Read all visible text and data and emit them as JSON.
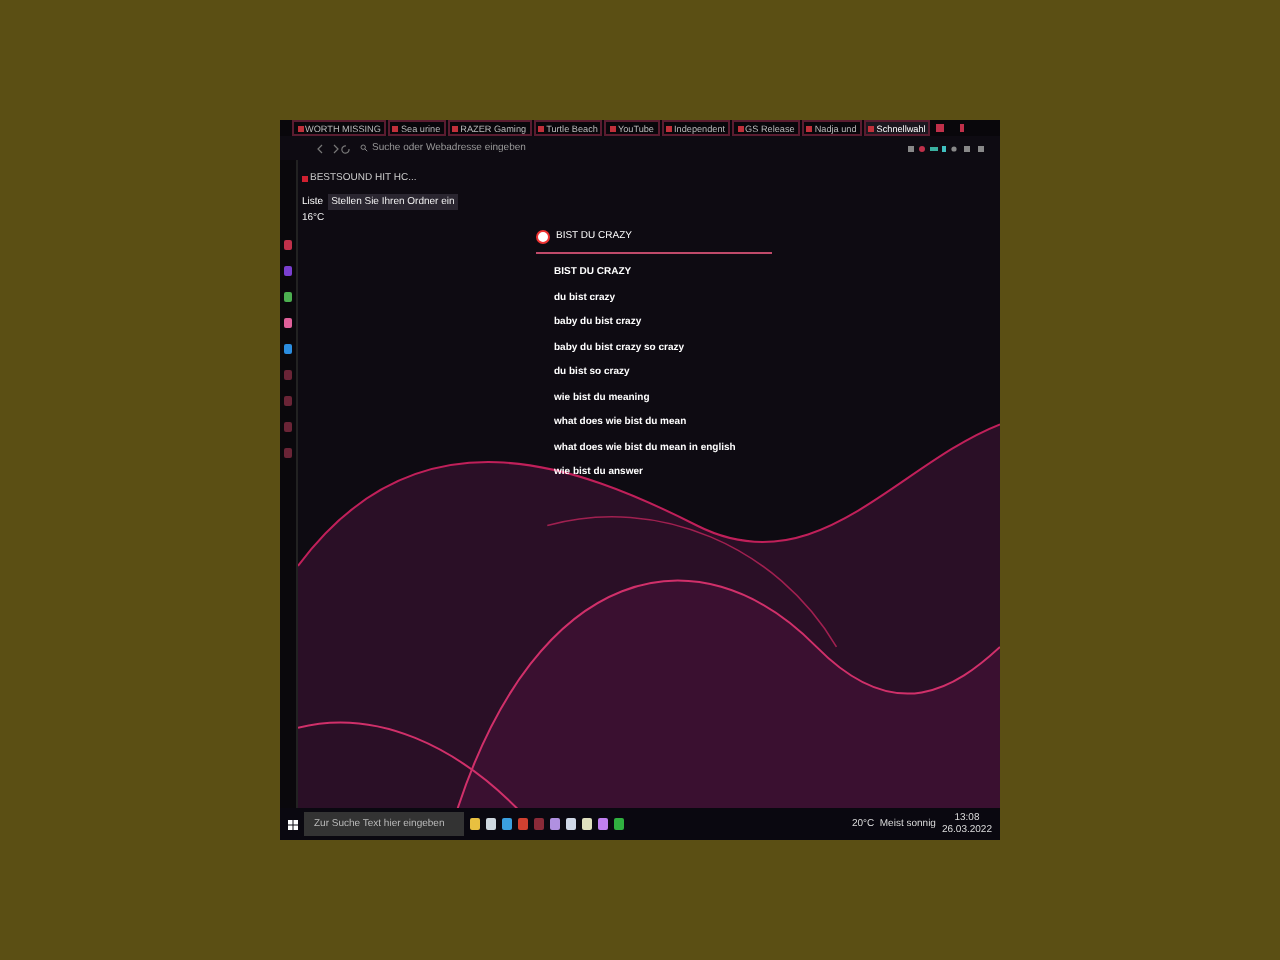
{
  "tabs": [
    {
      "label": "WORTH MISSING",
      "selected": false
    },
    {
      "label": "Sea urine",
      "selected": false
    },
    {
      "label": "RAZER Gaming",
      "selected": false
    },
    {
      "label": "Turtle Beach",
      "selected": false
    },
    {
      "label": "YouTube",
      "selected": false
    },
    {
      "label": "Independent",
      "selected": false
    },
    {
      "label": "GS Release",
      "selected": false
    },
    {
      "label": "Nadja und",
      "selected": false
    },
    {
      "label": "Schnellwahl",
      "selected": true
    }
  ],
  "address_bar": {
    "placeholder": "Suche oder Webadresse eingeben"
  },
  "bookmark": "BESTSOUND HIT HC...",
  "folder_row": {
    "label": "Liste",
    "chip": "Stellen Sie Ihren Ordner ein"
  },
  "weather": "16°C",
  "search": {
    "value": "BIST DU CRAZY"
  },
  "suggestions": [
    "BIST DU CRAZY",
    "du bist crazy",
    "baby du bist crazy",
    "baby du bist crazy so crazy",
    "du bist so crazy",
    "wie bist du meaning",
    "what does wie bist du mean",
    "what does wie bist du mean in english",
    "wie bist du answer"
  ],
  "taskbar": {
    "search_placeholder": "Zur Suche Text hier eingeben",
    "weather": "20°C  Meist sonnig",
    "time": "13:08",
    "date": "26.03.2022"
  }
}
